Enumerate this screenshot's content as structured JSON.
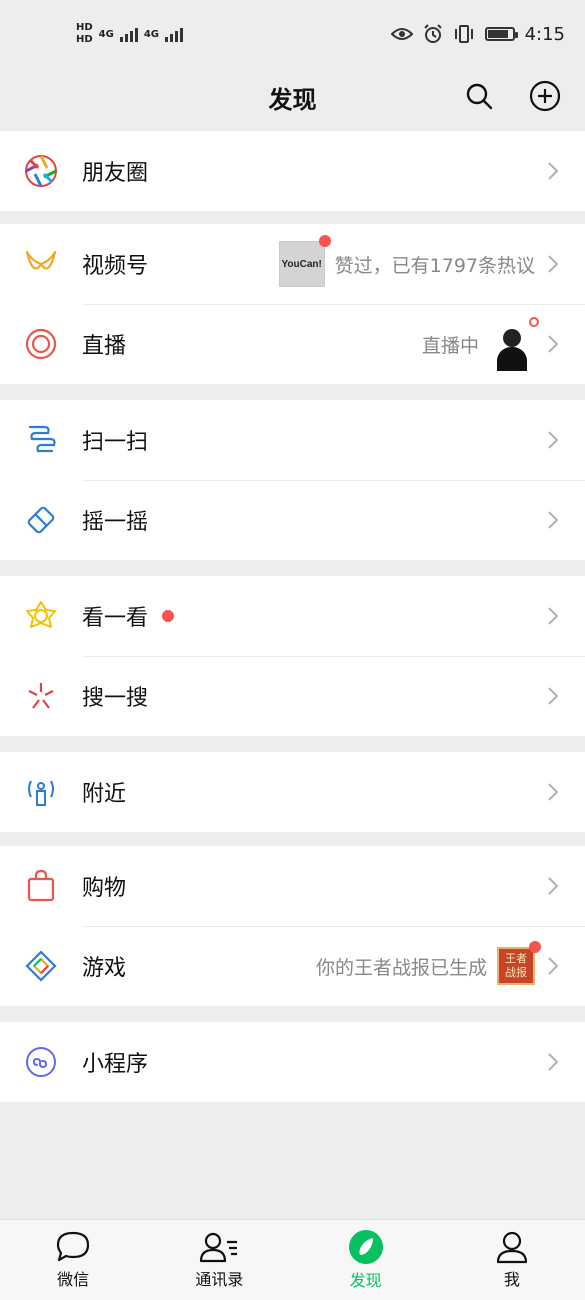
{
  "status_bar": {
    "network_labels": [
      "HD",
      "HD"
    ],
    "network_type": [
      "4G",
      "4G"
    ],
    "time": "4:15"
  },
  "header": {
    "title": "发现",
    "icons": [
      "search-icon",
      "add-circle-icon"
    ]
  },
  "sections": {
    "moments": {
      "label": "朋友圈"
    },
    "channels": {
      "label": "视频号",
      "note": "赞过，已有1797条热议",
      "thumb_text": "YouCan!"
    },
    "live": {
      "label": "直播",
      "note": "直播中"
    },
    "scan": {
      "label": "扫一扫"
    },
    "shake": {
      "label": "摇一摇"
    },
    "top_stories": {
      "label": "看一看"
    },
    "search": {
      "label": "搜一搜"
    },
    "nearby": {
      "label": "附近"
    },
    "shopping": {
      "label": "购物"
    },
    "games": {
      "label": "游戏",
      "note": "你的王者战报已生成",
      "badge_text": "王者战报"
    },
    "mini_programs": {
      "label": "小程序"
    }
  },
  "tabbar": {
    "tabs": [
      {
        "label": "微信",
        "icon": "chat-bubble-icon"
      },
      {
        "label": "通讯录",
        "icon": "contacts-icon"
      },
      {
        "label": "发现",
        "icon": "compass-icon",
        "active": true
      },
      {
        "label": "我",
        "icon": "person-icon"
      }
    ]
  },
  "colors": {
    "accent": "#07c160",
    "badge_red": "#fa5151",
    "background": "#ededed"
  }
}
